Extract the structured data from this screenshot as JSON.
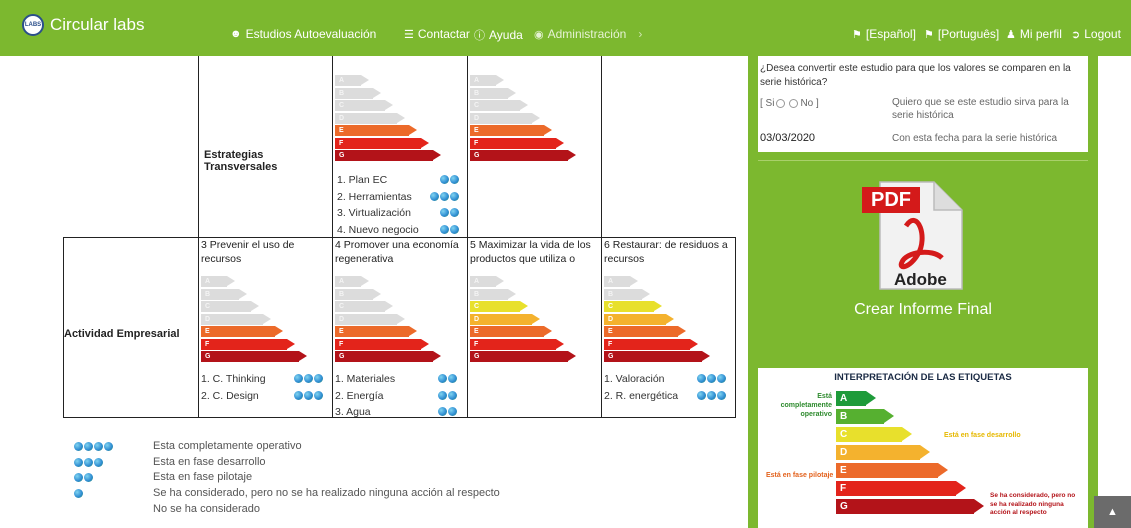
{
  "navbar": {
    "brand": "Circular labs",
    "brand_logo": "LABS",
    "items": [
      {
        "icon": "users-icon",
        "label": "Estudios Autoevaluación"
      },
      {
        "icon": "list-icon",
        "label": "Contactar"
      },
      {
        "icon": "info-icon",
        "label": "Ayuda"
      },
      {
        "icon": "user-circle-icon",
        "label": "Administración",
        "chevron": "›"
      }
    ],
    "right": [
      {
        "icon": "flag-icon",
        "label": "[Español]"
      },
      {
        "icon": "flag-icon",
        "label": "[Português]"
      },
      {
        "icon": "user-icon",
        "label": "Mi perfil"
      },
      {
        "icon": "logout-icon",
        "label": "Logout"
      }
    ]
  },
  "table": {
    "rows": [
      {
        "label": "Estrategias Transversales"
      },
      {
        "label": "Actividad Empresarial"
      }
    ],
    "cells": {
      "r1c2": {
        "title": "",
        "grades": [
          "A",
          "B",
          "C",
          "D",
          "E",
          "F",
          "G"
        ],
        "items": [
          {
            "text": "1. Plan EC",
            "level": 2
          },
          {
            "text": "2. Herramientas",
            "level": 3
          },
          {
            "text": "3. Virtualización",
            "level": 2
          },
          {
            "text": "4. Nuevo negocio",
            "level": 2
          }
        ]
      },
      "r1c3": {
        "title": "",
        "items": []
      },
      "r2c1": {
        "title": "3 Prevenir el uso de recursos",
        "items": [
          {
            "text": "1. C. Thinking",
            "level": 3
          },
          {
            "text": "2. C. Design",
            "level": 3
          }
        ]
      },
      "r2c2": {
        "title": "4 Promover una economía regenerativa",
        "items": [
          {
            "text": "1. Materiales",
            "level": 2
          },
          {
            "text": "2. Energía",
            "level": 2
          },
          {
            "text": "3. Agua",
            "level": 2
          }
        ]
      },
      "r2c3": {
        "title": "5 Maximizar la vida de los productos que utiliza o",
        "items": []
      },
      "r2c4": {
        "title": "6 Restaurar: de residuos a recursos",
        "items": [
          {
            "text": "1. Valoración",
            "level": 3
          },
          {
            "text": "2. R. energética",
            "level": 3
          }
        ]
      }
    }
  },
  "legend": [
    {
      "level": 4,
      "text": "Esta completamente operativo"
    },
    {
      "level": 3,
      "text": "Esta en fase desarrollo"
    },
    {
      "level": 2,
      "text": "Esta en fase pilotaje"
    },
    {
      "level": 1,
      "text": "Se ha considerado, pero no se ha realizado ninguna acción al respecto"
    },
    {
      "level": 0,
      "text": "No se ha considerado"
    }
  ],
  "sidebar": {
    "question": "¿Desea convertir este estudio para que los valores se comparen en la serie histórica?",
    "radio_label": "[ Si",
    "radio_no": "No ]",
    "radio_hint": "Quiero que se este estudio sirva para la serie histórica",
    "date_value": "03/03/2020",
    "date_hint": "Con esta fecha para la serie histórica",
    "pdf_badge": "PDF",
    "pdf_brand": "Adobe",
    "crear": "Crear Informe Final",
    "interp_title": "INTERPRETACIÓN DE LAS ETIQUETAS",
    "interp_operativo": "Está completamente operativo",
    "interp_desarrollo": "Está en fase desarrollo",
    "interp_pilotaje": "Está en fase pilotaje",
    "interp_considerado": "Se ha considerado, pero no se ha realizado ninguna acción al respecto",
    "interp_grades": [
      "A",
      "B",
      "C",
      "D",
      "E",
      "F",
      "G"
    ]
  },
  "colors": {
    "brand_green": "#7cb82f",
    "A": "#1e9b3a",
    "B": "#56b030",
    "C": "#e8e02c",
    "D": "#f4b22e",
    "E": "#ec6a2a",
    "F": "#e3241b",
    "G": "#b31319",
    "off": "#dcdcdc"
  },
  "scroll_top_icon": "chevron-up-icon"
}
